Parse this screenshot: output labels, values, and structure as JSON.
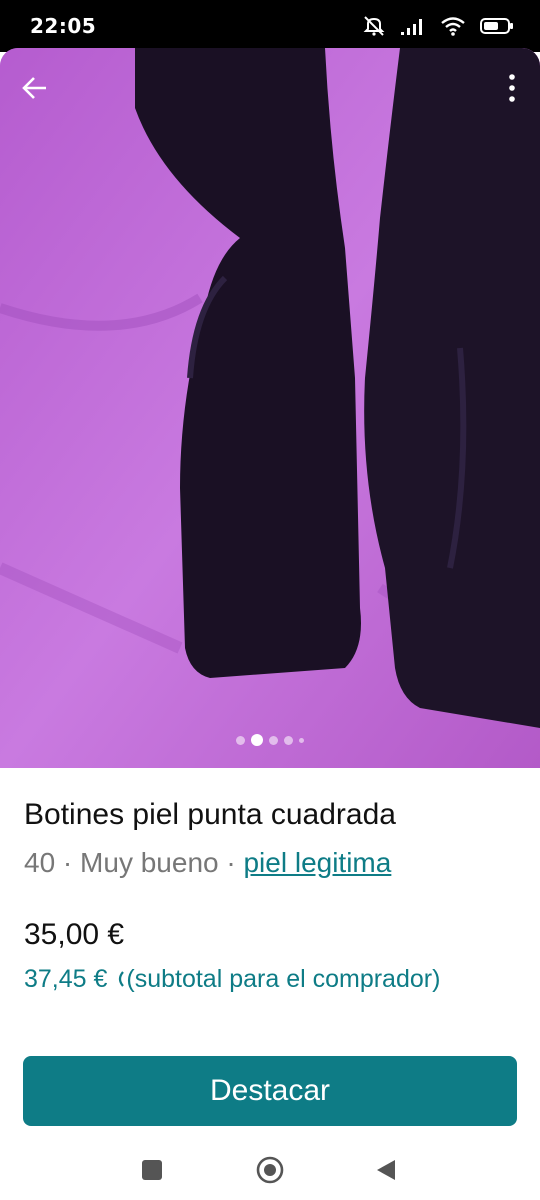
{
  "status_bar": {
    "time": "22:05",
    "icons": [
      "mute-icon",
      "signal-icon",
      "wifi-icon",
      "battery-icon"
    ]
  },
  "photo": {
    "alt": "Botines negros sobre colcha morada",
    "carousel": {
      "count": 5,
      "active_index": 1
    },
    "colors": {
      "background": "#c060d6",
      "boots": "#1a1024"
    }
  },
  "top_bar": {
    "back_icon": "arrow-left-icon",
    "menu_icon": "more-vertical-icon"
  },
  "item": {
    "title": "Botines piel punta cuadrada",
    "size": "40",
    "separator": " · ",
    "condition": "Muy bueno",
    "brand": "piel legitima",
    "price": "35,00 €",
    "buyer_total": "37,45 €",
    "buyer_total_icon": "info-icon",
    "buyer_total_note": "(subtotal para el comprador)"
  },
  "actions": {
    "primary": "Destacar",
    "accent": "#0e7c86"
  },
  "system_nav": [
    "recent-apps-icon",
    "home-icon",
    "back-triangle-icon"
  ]
}
